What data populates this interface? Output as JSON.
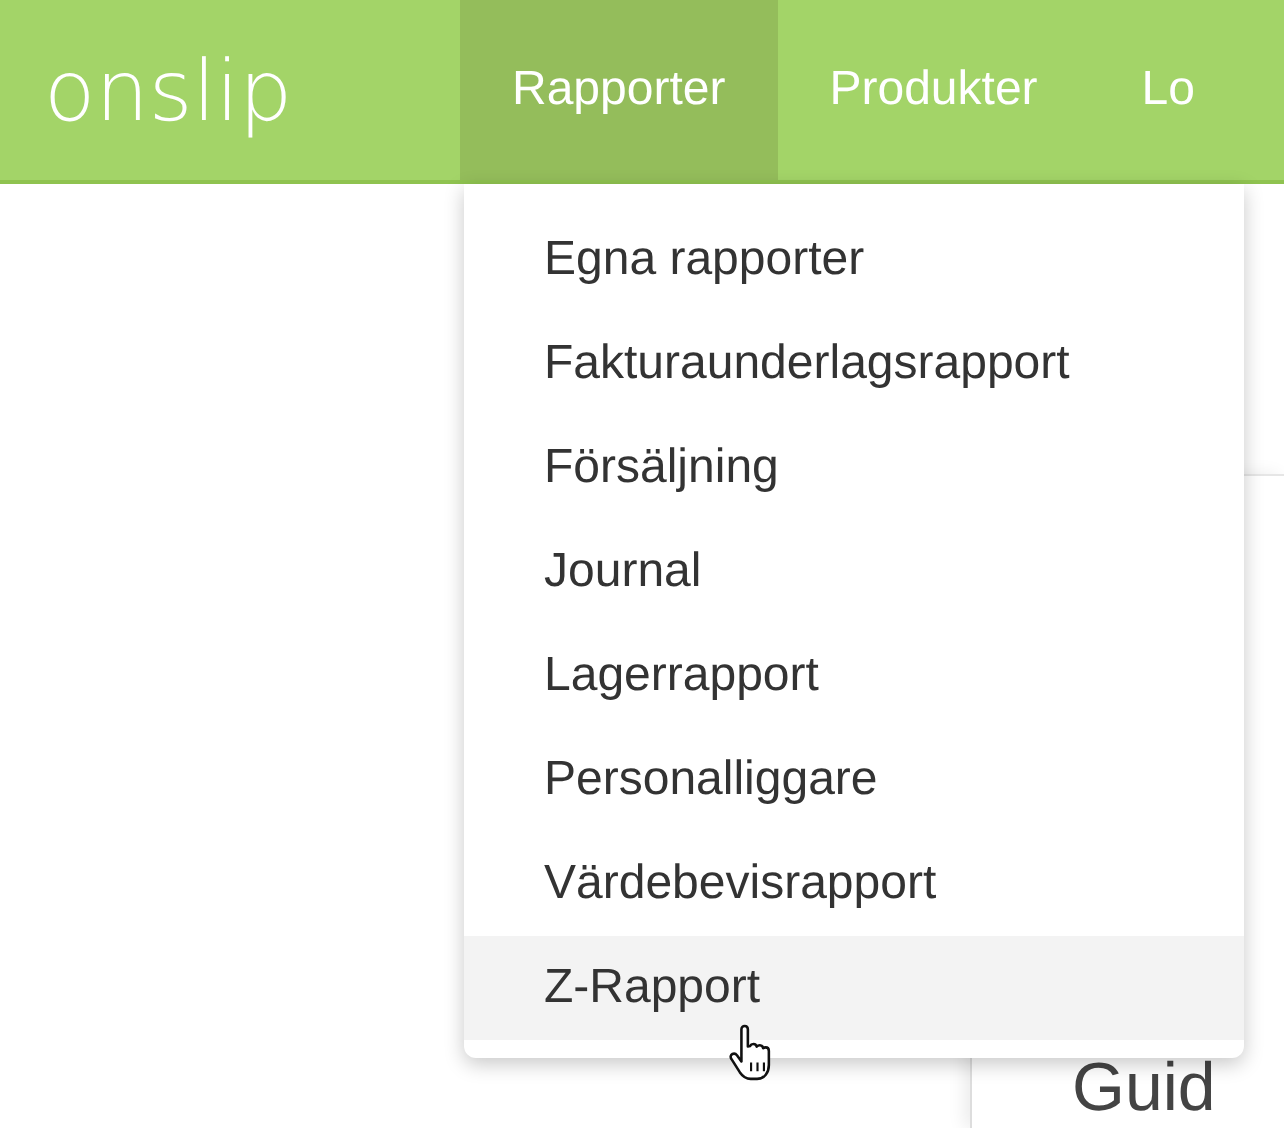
{
  "navbar": {
    "logo": "onslip",
    "items": [
      {
        "label": "Rapporter",
        "selected": true
      },
      {
        "label": "Produkter",
        "selected": false
      },
      {
        "label": "Lo",
        "selected": false
      }
    ]
  },
  "dropdown": {
    "items": [
      {
        "label": "Egna rapporter",
        "hovered": false
      },
      {
        "label": "Fakturaunderlagsrapport",
        "hovered": false
      },
      {
        "label": "Försäljning",
        "hovered": false
      },
      {
        "label": "Journal",
        "hovered": false
      },
      {
        "label": "Lagerrapport",
        "hovered": false
      },
      {
        "label": "Personalliggare",
        "hovered": false
      },
      {
        "label": "Värdebevisrapport",
        "hovered": false
      },
      {
        "label": "Z-Rapport",
        "hovered": true
      }
    ]
  },
  "card": {
    "heading": "Guid"
  }
}
